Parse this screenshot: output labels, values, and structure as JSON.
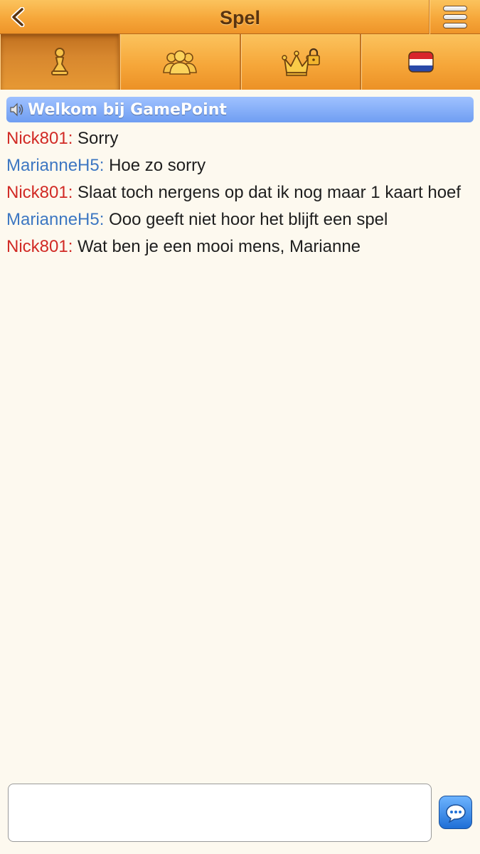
{
  "header": {
    "title": "Spel",
    "back_icon": "chevron-left-icon",
    "menu_icon": "menu-icon"
  },
  "tabs": [
    {
      "name": "game",
      "icon": "pawn-icon",
      "active": true
    },
    {
      "name": "players",
      "icon": "people-icon",
      "active": false
    },
    {
      "name": "vip",
      "icon": "crown-lock-icon",
      "active": false
    },
    {
      "name": "language",
      "icon": "dutch-flag-icon",
      "active": false
    }
  ],
  "chat": {
    "welcome": "Welkom bij GamePoint",
    "messages": [
      {
        "user": "Nick801:",
        "text": "Sorry",
        "color": "#d12a25"
      },
      {
        "user": "MarianneH5:",
        "text": "Hoe zo sorry",
        "color": "#3d77c2"
      },
      {
        "user": "Nick801:",
        "text": "Slaat toch nergens op dat ik nog maar 1 kaart hoef",
        "color": "#d12a25"
      },
      {
        "user": "MarianneH5:",
        "text": "Ooo geeft niet hoor het blijft een spel",
        "color": "#3d77c2"
      },
      {
        "user": "Nick801:",
        "text": "Wat ben je een mooi mens, Marianne",
        "color": "#d12a25"
      }
    ]
  },
  "input": {
    "placeholder": "",
    "send_icon": "chat-bubble-icon"
  },
  "colors": {
    "header": "#f6a73a",
    "welcome": "#6f9ef2",
    "background": "#fdf9ef"
  }
}
